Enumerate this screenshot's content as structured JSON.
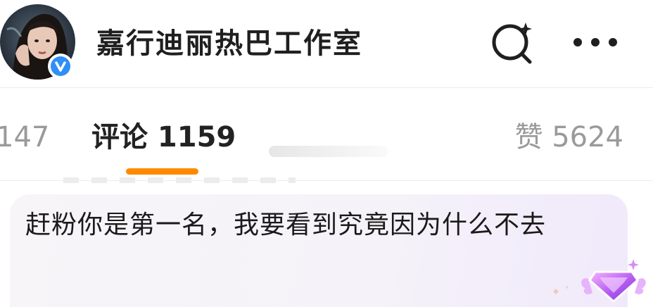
{
  "header": {
    "account_name": "嘉行迪丽热巴工作室",
    "verified_icon": "verified-badge-icon",
    "search_icon": "search-sparkle-icon",
    "more_icon": "more-dots-icon"
  },
  "tabs": {
    "reposts_count": "147",
    "comments_label": "评论 1159",
    "likes_label": "赞 5624",
    "active_color": "#ff8a00"
  },
  "comment": {
    "text": "赶粉你是第一名，我要看到究竟因为什么不去",
    "badge_icon": "diamond-badge-icon"
  }
}
